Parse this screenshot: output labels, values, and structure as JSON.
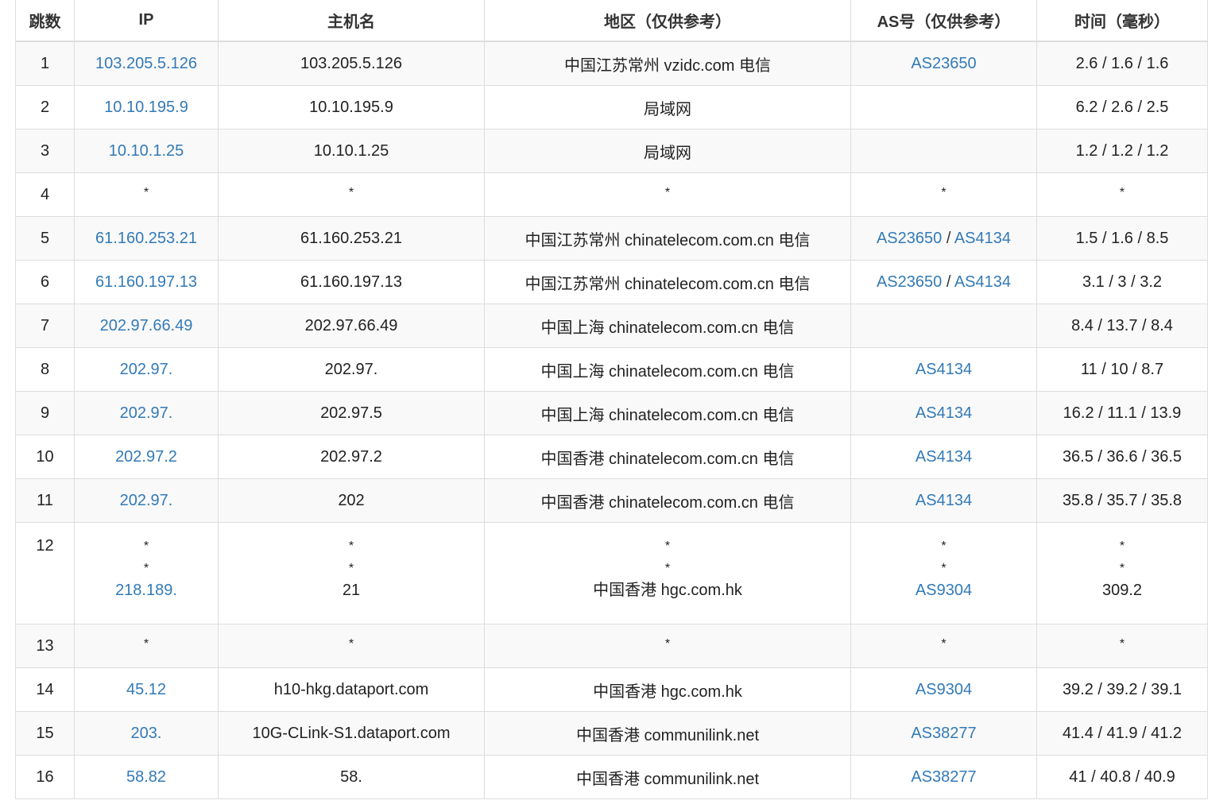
{
  "headers": [
    "跳数",
    "IP",
    "主机名",
    "地区（仅供参考）",
    "AS号（仅供参考）",
    "时间（毫秒）"
  ],
  "rows": [
    {
      "hop": "1",
      "ip": "103.205.5.126",
      "host": "103.205.5.126",
      "region": "中国江苏常州 vzidc.com 电信",
      "as": [
        "AS23650"
      ],
      "time": "2.6 / 1.6 / 1.6"
    },
    {
      "hop": "2",
      "ip": "10.10.195.9",
      "host": "10.10.195.9",
      "region": "局域网",
      "as": [],
      "time": "6.2 / 2.6 / 2.5"
    },
    {
      "hop": "3",
      "ip": "10.10.1.25",
      "host": "10.10.1.25",
      "region": "局域网",
      "as": [],
      "time": "1.2 / 1.2 / 1.2"
    },
    {
      "hop": "4",
      "ip": "*",
      "host": "*",
      "region": "*",
      "as": [
        "*"
      ],
      "time": "*"
    },
    {
      "hop": "5",
      "ip": "61.160.253.21",
      "host": "61.160.253.21",
      "region": "中国江苏常州 chinatelecom.com.cn 电信",
      "as": [
        "AS23650",
        "AS4134"
      ],
      "time": "1.5 / 1.6 / 8.5"
    },
    {
      "hop": "6",
      "ip": "61.160.197.13",
      "host": "61.160.197.13",
      "region": "中国江苏常州 chinatelecom.com.cn 电信",
      "as": [
        "AS23650",
        "AS4134"
      ],
      "time": "3.1 / 3 / 3.2"
    },
    {
      "hop": "7",
      "ip": "202.97.66.49",
      "host": "202.97.66.49",
      "region": "中国上海 chinatelecom.com.cn 电信",
      "as": [],
      "time": "8.4 / 13.7 / 8.4"
    },
    {
      "hop": "8",
      "ip": "202.97.",
      "host": "202.97.",
      "region": "中国上海 chinatelecom.com.cn 电信",
      "as": [
        "AS4134"
      ],
      "time": "11 / 10 / 8.7"
    },
    {
      "hop": "9",
      "ip": "202.97.",
      "host": "202.97.5",
      "region": "中国上海 chinatelecom.com.cn 电信",
      "as": [
        "AS4134"
      ],
      "time": "16.2 / 11.1 / 13.9"
    },
    {
      "hop": "10",
      "ip": "202.97.2",
      "host": "202.97.2",
      "region": "中国香港 chinatelecom.com.cn 电信",
      "as": [
        "AS4134"
      ],
      "time": "36.5 / 36.6 / 36.5"
    },
    {
      "hop": "11",
      "ip": "202.97.",
      "host": "202",
      "region": "中国香港 chinatelecom.com.cn 电信",
      "as": [
        "AS4134"
      ],
      "time": "35.8 / 35.7 / 35.8"
    }
  ],
  "multi_row": {
    "hop": "12",
    "ip": [
      "*",
      "*",
      "218.189."
    ],
    "host": [
      "*",
      "*",
      "21"
    ],
    "region": [
      "*",
      "*",
      "中国香港 hgc.com.hk"
    ],
    "as": [
      "*",
      "*",
      "AS9304"
    ],
    "time": [
      "*",
      "*",
      "309.2"
    ]
  },
  "rows_after": [
    {
      "hop": "13",
      "ip": "*",
      "host": "*",
      "region": "*",
      "as": [
        "*"
      ],
      "time": "*"
    },
    {
      "hop": "14",
      "ip": "45.12",
      "host": "h10-hkg.dataport.com",
      "region": "中国香港 hgc.com.hk",
      "as": [
        "AS9304"
      ],
      "time": "39.2 / 39.2 / 39.1"
    },
    {
      "hop": "15",
      "ip": "203.",
      "host": "10G-CLink-S1.dataport.com",
      "region": "中国香港 communilink.net",
      "as": [
        "AS38277"
      ],
      "time": "41.4 / 41.9 / 41.2"
    },
    {
      "hop": "16",
      "ip": "58.82",
      "host": "58.",
      "region": "中国香港 communilink.net",
      "as": [
        "AS38277"
      ],
      "time": "41 / 40.8 / 40.9"
    }
  ]
}
